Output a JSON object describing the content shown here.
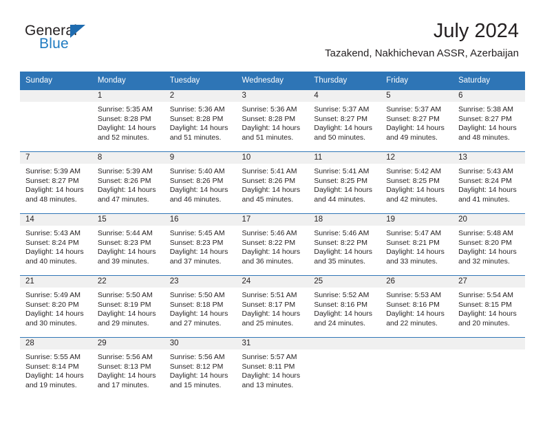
{
  "brand": {
    "name_part1": "General",
    "name_part2": "Blue",
    "triangle_color": "#1f6cb0",
    "blue_text_color": "#1f7bc1"
  },
  "header": {
    "month_title": "July 2024",
    "location": "Tazakend, Nakhichevan ASSR, Azerbaijan",
    "header_bg_color": "#2e75b6",
    "daynum_band_color": "#f0f0f0"
  },
  "calendar": {
    "weekday_headers": [
      "Sunday",
      "Monday",
      "Tuesday",
      "Wednesday",
      "Thursday",
      "Friday",
      "Saturday"
    ],
    "weeks": [
      [
        {
          "day": "",
          "empty": true,
          "sunrise": "",
          "sunset": "",
          "daylight_line1": "",
          "daylight_line2": ""
        },
        {
          "day": "1",
          "sunrise": "Sunrise: 5:35 AM",
          "sunset": "Sunset: 8:28 PM",
          "daylight_line1": "Daylight: 14 hours",
          "daylight_line2": "and 52 minutes."
        },
        {
          "day": "2",
          "sunrise": "Sunrise: 5:36 AM",
          "sunset": "Sunset: 8:28 PM",
          "daylight_line1": "Daylight: 14 hours",
          "daylight_line2": "and 51 minutes."
        },
        {
          "day": "3",
          "sunrise": "Sunrise: 5:36 AM",
          "sunset": "Sunset: 8:28 PM",
          "daylight_line1": "Daylight: 14 hours",
          "daylight_line2": "and 51 minutes."
        },
        {
          "day": "4",
          "sunrise": "Sunrise: 5:37 AM",
          "sunset": "Sunset: 8:27 PM",
          "daylight_line1": "Daylight: 14 hours",
          "daylight_line2": "and 50 minutes."
        },
        {
          "day": "5",
          "sunrise": "Sunrise: 5:37 AM",
          "sunset": "Sunset: 8:27 PM",
          "daylight_line1": "Daylight: 14 hours",
          "daylight_line2": "and 49 minutes."
        },
        {
          "day": "6",
          "sunrise": "Sunrise: 5:38 AM",
          "sunset": "Sunset: 8:27 PM",
          "daylight_line1": "Daylight: 14 hours",
          "daylight_line2": "and 48 minutes."
        }
      ],
      [
        {
          "day": "7",
          "sunrise": "Sunrise: 5:39 AM",
          "sunset": "Sunset: 8:27 PM",
          "daylight_line1": "Daylight: 14 hours",
          "daylight_line2": "and 48 minutes."
        },
        {
          "day": "8",
          "sunrise": "Sunrise: 5:39 AM",
          "sunset": "Sunset: 8:26 PM",
          "daylight_line1": "Daylight: 14 hours",
          "daylight_line2": "and 47 minutes."
        },
        {
          "day": "9",
          "sunrise": "Sunrise: 5:40 AM",
          "sunset": "Sunset: 8:26 PM",
          "daylight_line1": "Daylight: 14 hours",
          "daylight_line2": "and 46 minutes."
        },
        {
          "day": "10",
          "sunrise": "Sunrise: 5:41 AM",
          "sunset": "Sunset: 8:26 PM",
          "daylight_line1": "Daylight: 14 hours",
          "daylight_line2": "and 45 minutes."
        },
        {
          "day": "11",
          "sunrise": "Sunrise: 5:41 AM",
          "sunset": "Sunset: 8:25 PM",
          "daylight_line1": "Daylight: 14 hours",
          "daylight_line2": "and 44 minutes."
        },
        {
          "day": "12",
          "sunrise": "Sunrise: 5:42 AM",
          "sunset": "Sunset: 8:25 PM",
          "daylight_line1": "Daylight: 14 hours",
          "daylight_line2": "and 42 minutes."
        },
        {
          "day": "13",
          "sunrise": "Sunrise: 5:43 AM",
          "sunset": "Sunset: 8:24 PM",
          "daylight_line1": "Daylight: 14 hours",
          "daylight_line2": "and 41 minutes."
        }
      ],
      [
        {
          "day": "14",
          "sunrise": "Sunrise: 5:43 AM",
          "sunset": "Sunset: 8:24 PM",
          "daylight_line1": "Daylight: 14 hours",
          "daylight_line2": "and 40 minutes."
        },
        {
          "day": "15",
          "sunrise": "Sunrise: 5:44 AM",
          "sunset": "Sunset: 8:23 PM",
          "daylight_line1": "Daylight: 14 hours",
          "daylight_line2": "and 39 minutes."
        },
        {
          "day": "16",
          "sunrise": "Sunrise: 5:45 AM",
          "sunset": "Sunset: 8:23 PM",
          "daylight_line1": "Daylight: 14 hours",
          "daylight_line2": "and 37 minutes."
        },
        {
          "day": "17",
          "sunrise": "Sunrise: 5:46 AM",
          "sunset": "Sunset: 8:22 PM",
          "daylight_line1": "Daylight: 14 hours",
          "daylight_line2": "and 36 minutes."
        },
        {
          "day": "18",
          "sunrise": "Sunrise: 5:46 AM",
          "sunset": "Sunset: 8:22 PM",
          "daylight_line1": "Daylight: 14 hours",
          "daylight_line2": "and 35 minutes."
        },
        {
          "day": "19",
          "sunrise": "Sunrise: 5:47 AM",
          "sunset": "Sunset: 8:21 PM",
          "daylight_line1": "Daylight: 14 hours",
          "daylight_line2": "and 33 minutes."
        },
        {
          "day": "20",
          "sunrise": "Sunrise: 5:48 AM",
          "sunset": "Sunset: 8:20 PM",
          "daylight_line1": "Daylight: 14 hours",
          "daylight_line2": "and 32 minutes."
        }
      ],
      [
        {
          "day": "21",
          "sunrise": "Sunrise: 5:49 AM",
          "sunset": "Sunset: 8:20 PM",
          "daylight_line1": "Daylight: 14 hours",
          "daylight_line2": "and 30 minutes."
        },
        {
          "day": "22",
          "sunrise": "Sunrise: 5:50 AM",
          "sunset": "Sunset: 8:19 PM",
          "daylight_line1": "Daylight: 14 hours",
          "daylight_line2": "and 29 minutes."
        },
        {
          "day": "23",
          "sunrise": "Sunrise: 5:50 AM",
          "sunset": "Sunset: 8:18 PM",
          "daylight_line1": "Daylight: 14 hours",
          "daylight_line2": "and 27 minutes."
        },
        {
          "day": "24",
          "sunrise": "Sunrise: 5:51 AM",
          "sunset": "Sunset: 8:17 PM",
          "daylight_line1": "Daylight: 14 hours",
          "daylight_line2": "and 25 minutes."
        },
        {
          "day": "25",
          "sunrise": "Sunrise: 5:52 AM",
          "sunset": "Sunset: 8:16 PM",
          "daylight_line1": "Daylight: 14 hours",
          "daylight_line2": "and 24 minutes."
        },
        {
          "day": "26",
          "sunrise": "Sunrise: 5:53 AM",
          "sunset": "Sunset: 8:16 PM",
          "daylight_line1": "Daylight: 14 hours",
          "daylight_line2": "and 22 minutes."
        },
        {
          "day": "27",
          "sunrise": "Sunrise: 5:54 AM",
          "sunset": "Sunset: 8:15 PM",
          "daylight_line1": "Daylight: 14 hours",
          "daylight_line2": "and 20 minutes."
        }
      ],
      [
        {
          "day": "28",
          "sunrise": "Sunrise: 5:55 AM",
          "sunset": "Sunset: 8:14 PM",
          "daylight_line1": "Daylight: 14 hours",
          "daylight_line2": "and 19 minutes."
        },
        {
          "day": "29",
          "sunrise": "Sunrise: 5:56 AM",
          "sunset": "Sunset: 8:13 PM",
          "daylight_line1": "Daylight: 14 hours",
          "daylight_line2": "and 17 minutes."
        },
        {
          "day": "30",
          "sunrise": "Sunrise: 5:56 AM",
          "sunset": "Sunset: 8:12 PM",
          "daylight_line1": "Daylight: 14 hours",
          "daylight_line2": "and 15 minutes."
        },
        {
          "day": "31",
          "sunrise": "Sunrise: 5:57 AM",
          "sunset": "Sunset: 8:11 PM",
          "daylight_line1": "Daylight: 14 hours",
          "daylight_line2": "and 13 minutes."
        },
        {
          "day": "",
          "empty": true,
          "sunrise": "",
          "sunset": "",
          "daylight_line1": "",
          "daylight_line2": ""
        },
        {
          "day": "",
          "empty": true,
          "sunrise": "",
          "sunset": "",
          "daylight_line1": "",
          "daylight_line2": ""
        },
        {
          "day": "",
          "empty": true,
          "sunrise": "",
          "sunset": "",
          "daylight_line1": "",
          "daylight_line2": ""
        }
      ]
    ]
  }
}
